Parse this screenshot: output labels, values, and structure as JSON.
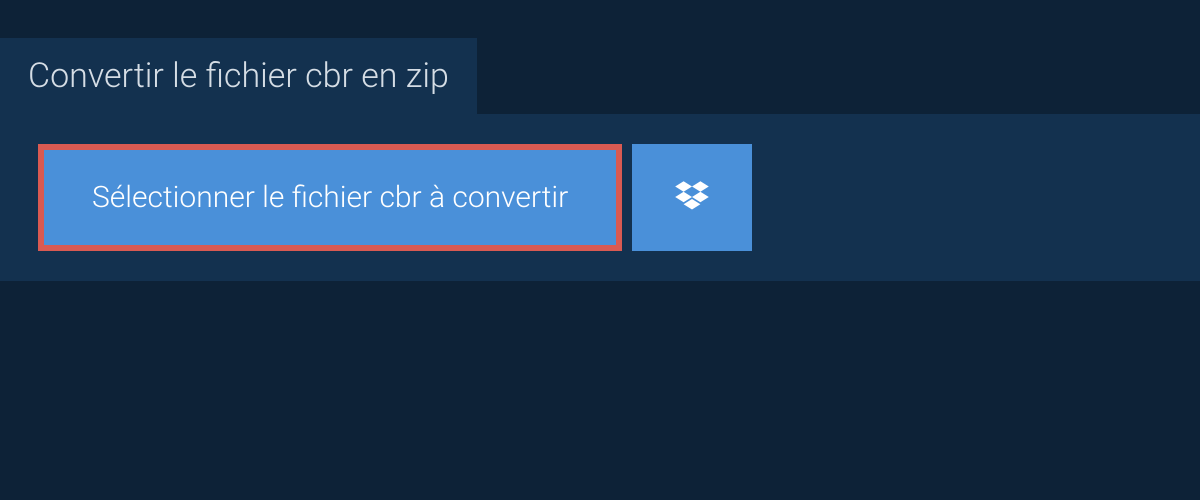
{
  "header": {
    "title": "Convertir le fichier cbr en zip"
  },
  "buttons": {
    "select_file_label": "Sélectionner le fichier cbr à convertir"
  },
  "colors": {
    "background": "#0d2237",
    "panel": "#13314f",
    "button": "#4a90d9",
    "highlight_border": "#d95a52",
    "text_light": "#d5dde5"
  }
}
